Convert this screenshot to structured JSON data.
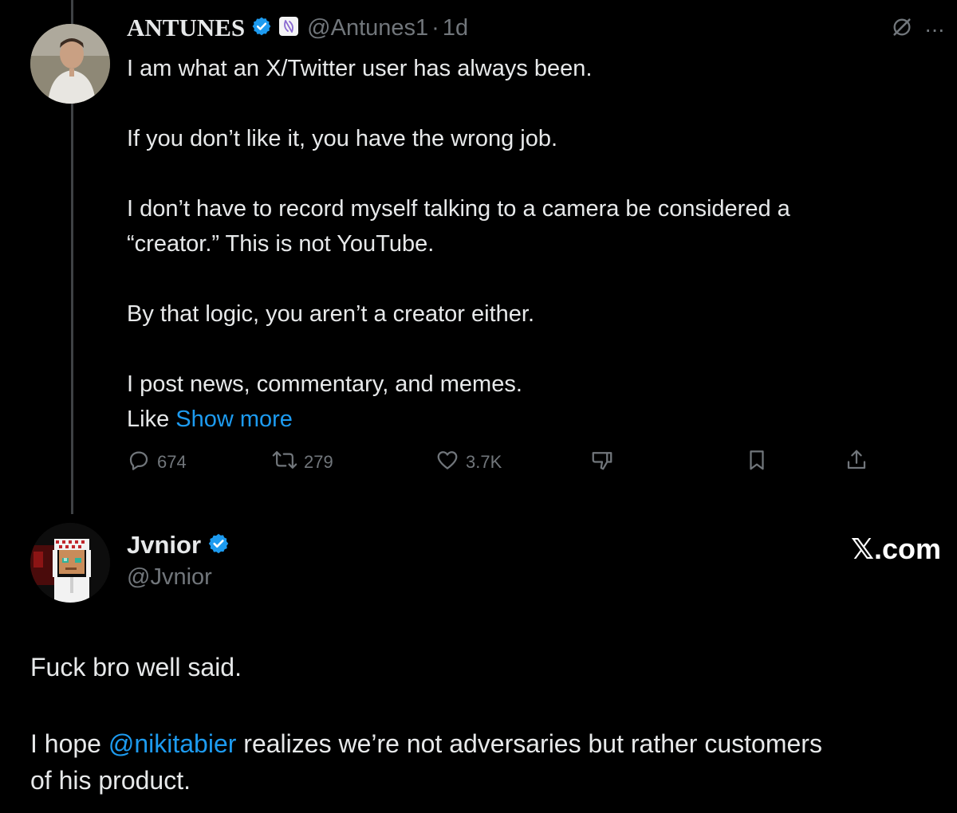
{
  "tweet1": {
    "author_name": "ANTUNES",
    "handle": "@Antunes1",
    "separator": "·",
    "time": "1d",
    "lines": [
      "I am what an X/Twitter user has always been.",
      "",
      "If you don’t like it, you have the wrong job.",
      "",
      "I don’t have to record myself talking to a camera be considered a",
      "“creator.” This is not YouTube.",
      "",
      "By that logic, you aren’t a creator either.",
      "",
      "I post news, commentary, and memes."
    ],
    "last_line_prefix": "Like",
    "show_more": "Show more",
    "stats": {
      "replies": "674",
      "reposts": "279",
      "likes": "3.7K"
    }
  },
  "tweet2": {
    "author_name": "Jvnior",
    "handle": "@Jvnior",
    "line1": "Fuck bro well said.",
    "line2_prefix": "I hope",
    "mention": "@nikitabier",
    "line2_suffix": "realizes we’re not adversaries but rather customers",
    "line3": "of his product."
  },
  "watermark": "𝕏.com",
  "colors": {
    "background": "#000000",
    "text": "#e7e9ea",
    "muted": "#71767b",
    "link": "#1d9bf0",
    "verified": "#1d9bf0"
  },
  "icons": [
    "verified-badge-icon",
    "affiliate-badge-icon",
    "grok-icon",
    "more-icon",
    "reply-icon",
    "repost-icon",
    "like-icon",
    "dislike-icon",
    "bookmark-icon",
    "share-icon"
  ]
}
